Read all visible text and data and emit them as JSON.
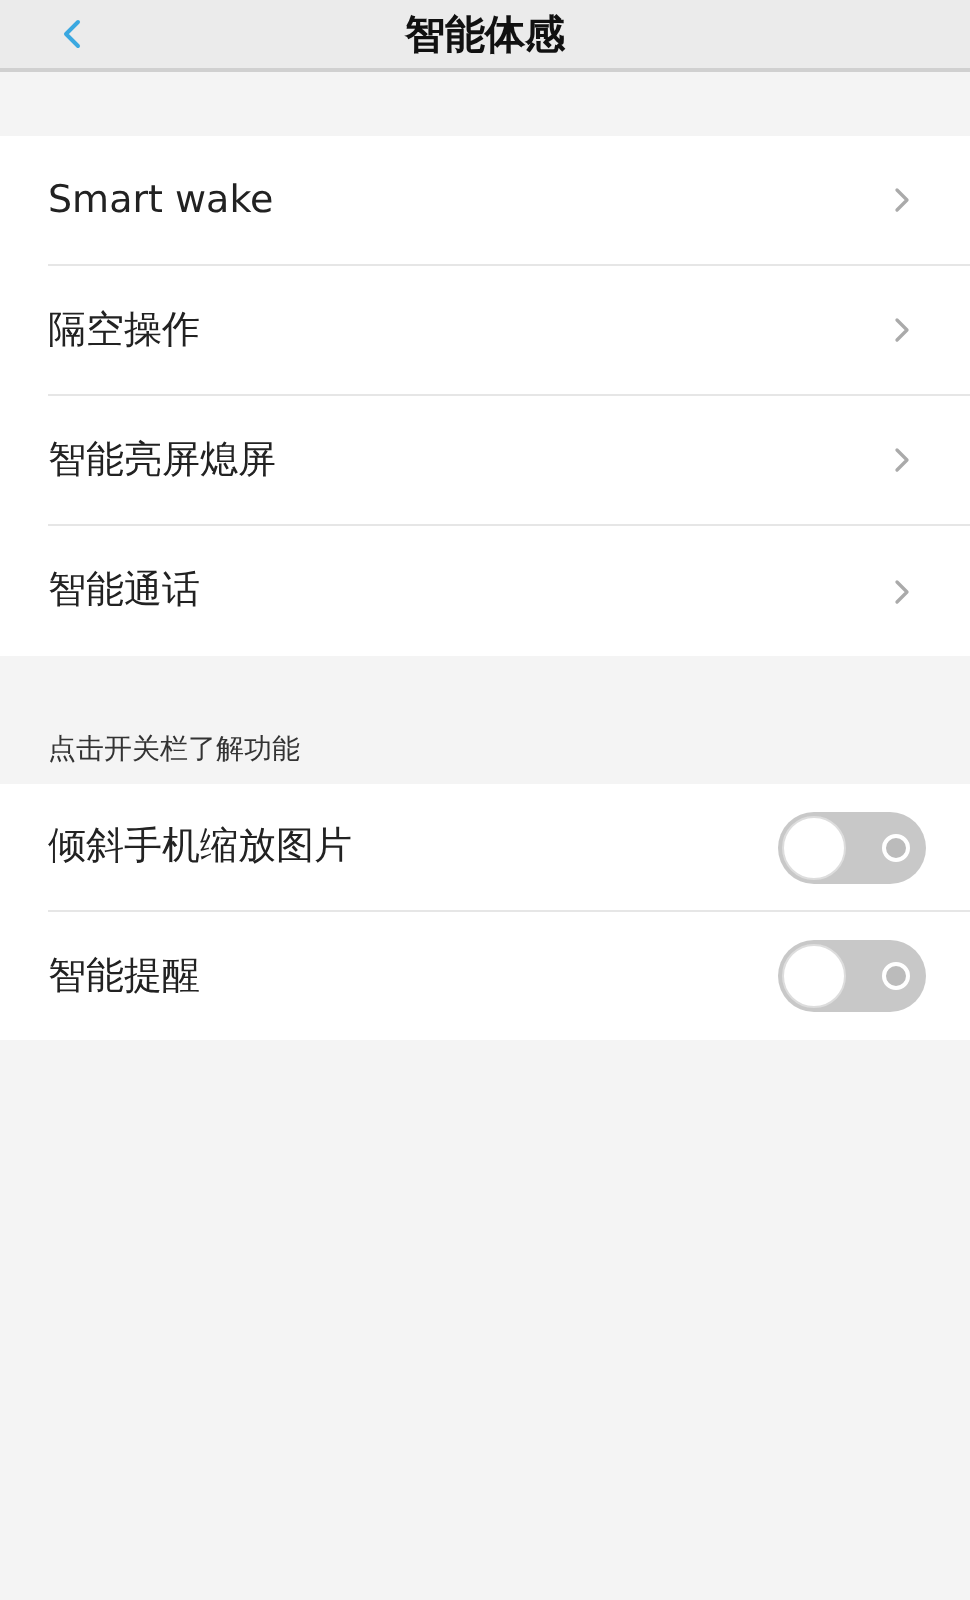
{
  "header": {
    "title": "智能体感"
  },
  "nav_items": [
    {
      "label": "Smart wake"
    },
    {
      "label": "隔空操作"
    },
    {
      "label": "智能亮屏熄屏"
    },
    {
      "label": "智能通话"
    }
  ],
  "section": {
    "label": "点击开关栏了解功能"
  },
  "toggles": [
    {
      "label": "倾斜手机缩放图片",
      "on": false
    },
    {
      "label": "智能提醒",
      "on": false
    }
  ]
}
